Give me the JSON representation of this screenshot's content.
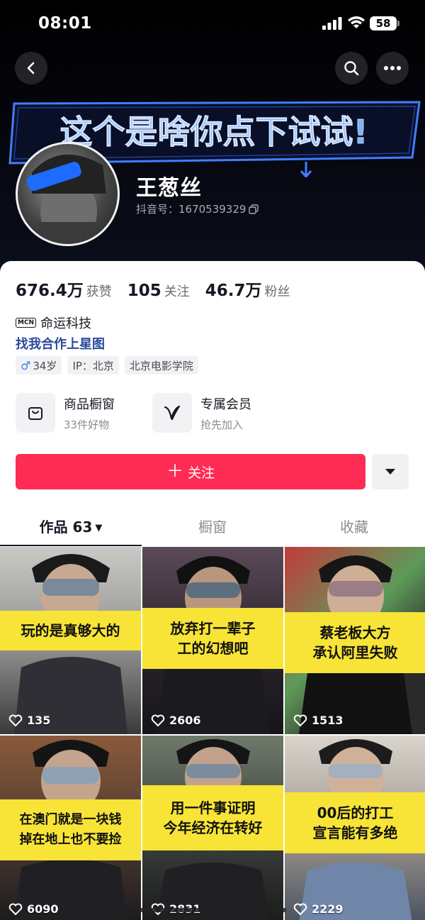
{
  "status_bar": {
    "time": "08:01",
    "battery": "58"
  },
  "profile": {
    "banner_text": "这个是啥你点下试试!",
    "name": "王葱丝",
    "douyin_id": "抖音号：1670539329"
  },
  "stats": [
    {
      "value": "676.4万",
      "label": "获赞"
    },
    {
      "value": "105",
      "label": "关注"
    },
    {
      "value": "46.7万",
      "label": "粉丝"
    }
  ],
  "mcn": {
    "badge": "MCN",
    "name": "命运科技"
  },
  "star_link": "找我合作上星图",
  "tags": {
    "age": "34岁",
    "ip": "IP：北京",
    "school": "北京电影学院"
  },
  "features": {
    "shop": {
      "title": "商品橱窗",
      "sub": "33件好物"
    },
    "member": {
      "title": "专属会员",
      "sub": "抢先加入"
    }
  },
  "follow_button": {
    "label": "关注"
  },
  "tabs": [
    {
      "label": "作品 63"
    },
    {
      "label": "橱窗"
    },
    {
      "label": "收藏"
    }
  ],
  "videos": [
    {
      "caption": "玩的是真够大的",
      "likes": "135"
    },
    {
      "caption": "放弃打一辈子\n工的幻想吧",
      "likes": "2606"
    },
    {
      "caption": "蔡老板大方\n承认阿里失败",
      "likes": "1513"
    },
    {
      "caption": "在澳门就是一块钱\n掉在地上也不要捡",
      "likes": "6090"
    },
    {
      "caption": "用一件事证明\n今年经济在转好",
      "likes": "2831"
    },
    {
      "caption": "00后的打工\n宣言能有多绝",
      "likes": "2229"
    }
  ],
  "colors": {
    "follow": "#fe2c55",
    "caption_bg": "#f7e436",
    "link": "#2a4a9a",
    "banner_text": "#7fb2ff"
  }
}
